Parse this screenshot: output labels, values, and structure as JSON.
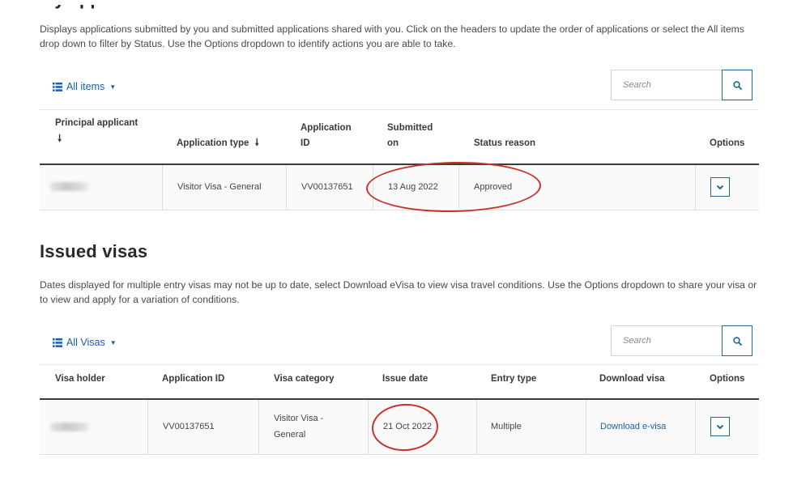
{
  "applications": {
    "cut_heading": "My applications",
    "description": "Displays applications submitted by you and submitted applications shared with you. Click on the headers to update the order of applications or select the All items drop down to filter by Status. Use the Options dropdown to identify actions you are able to take.",
    "filter_label": "All items",
    "search_placeholder": "Search",
    "columns": {
      "principal": "Principal applicant",
      "type": "Application type",
      "id_line1": "Application",
      "id_line2": "ID",
      "submitted_line1": "Submitted",
      "submitted_line2": "on",
      "status": "Status reason",
      "options": "Options"
    },
    "row": {
      "type": "Visitor Visa - General",
      "id": "VV00137651",
      "submitted": "13 Aug 2022",
      "status": "Approved"
    }
  },
  "visas": {
    "title": "Issued visas",
    "description": "Dates displayed for multiple entry visas may not be up to date, select Download eVisa to view visa travel conditions. Use the Options dropdown to share your visa or to view and apply for a variation of conditions.",
    "filter_label": "All Visas",
    "search_placeholder": "Search",
    "columns": {
      "holder": "Visa holder",
      "app_id": "Application ID",
      "category": "Visa category",
      "issue_date": "Issue date",
      "entry_type": "Entry type",
      "download": "Download visa",
      "options": "Options"
    },
    "row": {
      "app_id": "VV00137651",
      "category_line1": "Visitor Visa -",
      "category_line2": "General",
      "issue_date": "21 Oct 2022",
      "entry_type": "Multiple",
      "download_link": "Download e-visa"
    }
  },
  "annotation_color": "#c8322a",
  "accent_color": "#1a5ea8",
  "icons": {
    "list": "list-icon",
    "search": "search-icon",
    "sort": "sort-down-arrow-icon",
    "chevron": "chevron-down-icon"
  }
}
